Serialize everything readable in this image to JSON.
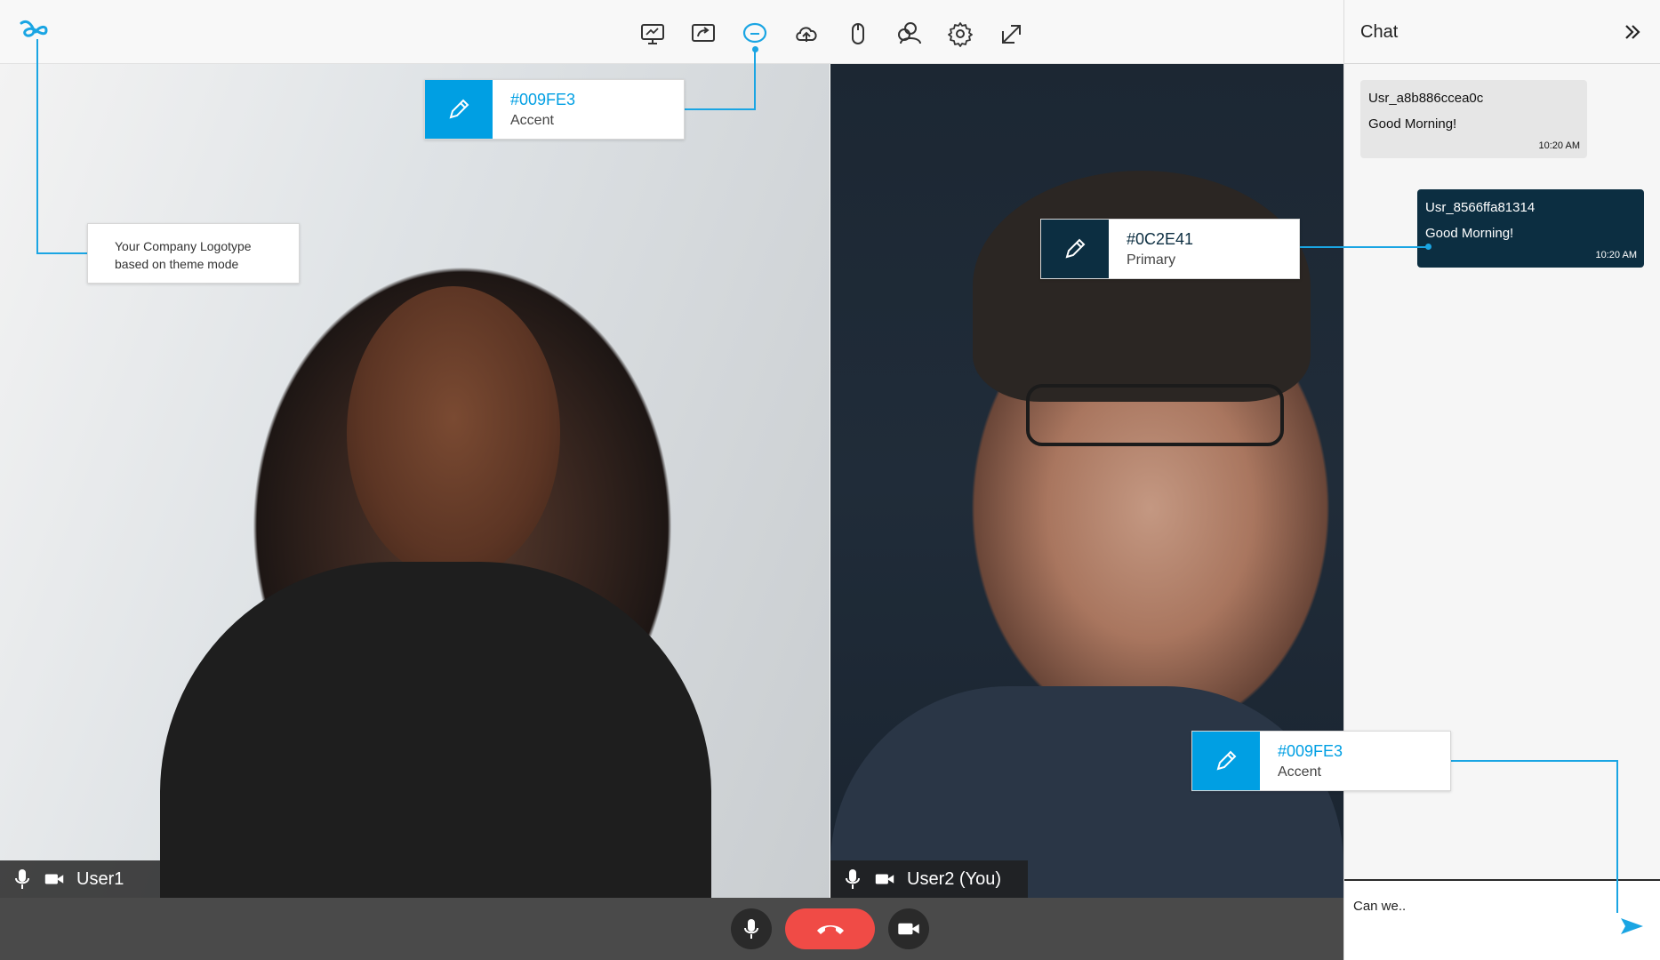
{
  "colors": {
    "accent": "#009FE3",
    "primary": "#0C2E41",
    "end_call": "#F04B46",
    "toolbar_icon": "#333333"
  },
  "toolbar": {
    "logo": "company-logo-icon",
    "icons": [
      "whiteboard-icon",
      "screen-share-icon",
      "chat-icon",
      "cloud-upload-icon",
      "mouse-icon",
      "participants-icon",
      "settings-icon",
      "expand-icon"
    ]
  },
  "videos": {
    "left": {
      "name": "User1"
    },
    "right": {
      "name": "User2 (You)"
    }
  },
  "chat": {
    "title": "Chat",
    "messages": [
      {
        "user": "Usr_a8b886ccea0c",
        "text": "Good Morning!",
        "time": "10:20 AM"
      },
      {
        "user": "Usr_8566ffa81314",
        "text": "Good Morning!",
        "time": "10:20 AM"
      }
    ],
    "input_value": "Can we.."
  },
  "callouts": {
    "accent_top": {
      "hex": "#009FE3",
      "role": "Accent"
    },
    "primary": {
      "hex": "#0C2E41",
      "role": "Primary"
    },
    "accent_bottom": {
      "hex": "#009FE3",
      "role": "Accent"
    },
    "logo_note_line1": "Your Company Logotype",
    "logo_note_line2": "based on theme mode"
  }
}
